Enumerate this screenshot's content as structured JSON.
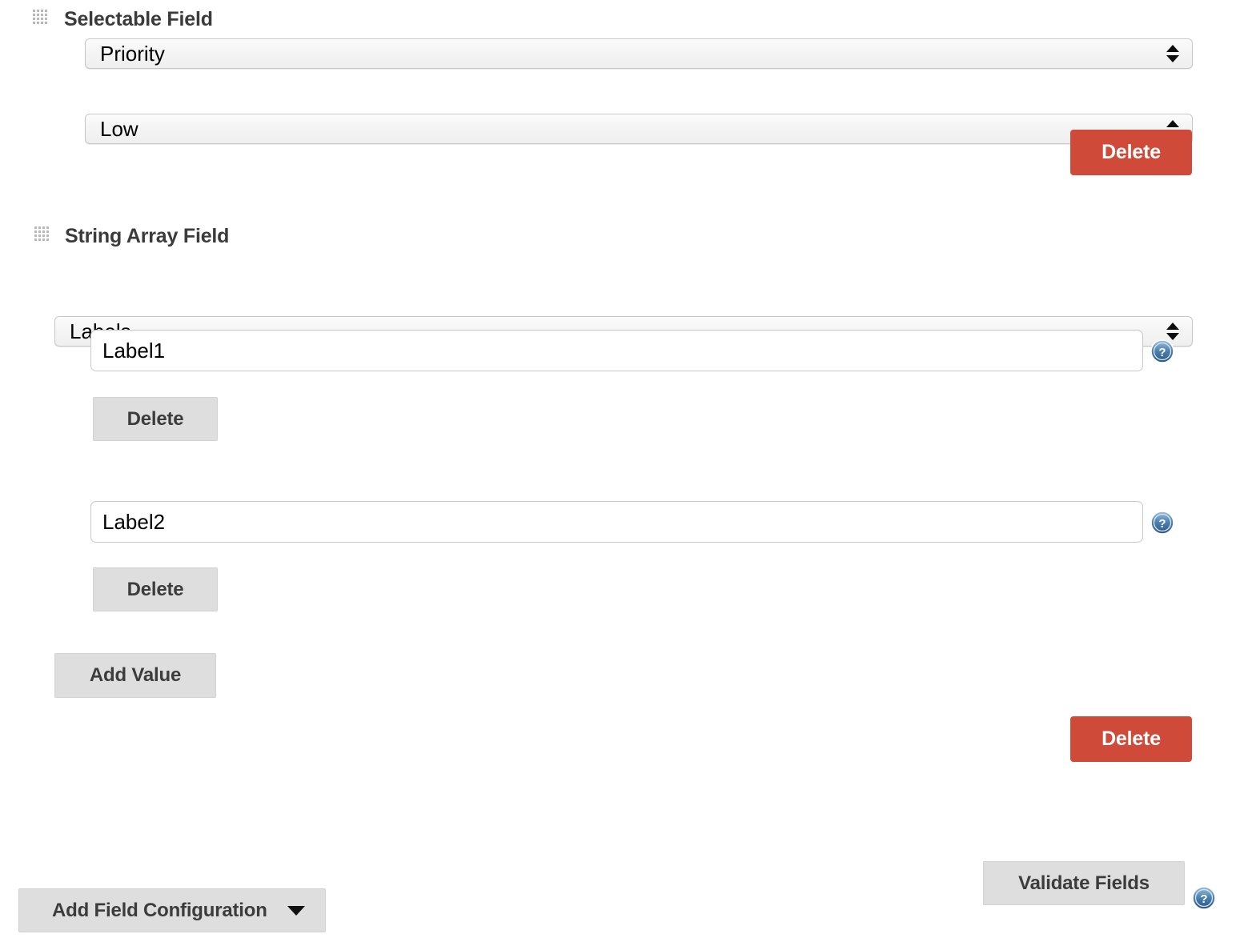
{
  "sections": [
    {
      "title": "Selectable Field",
      "drag_handle_icon": "drag-grip-icon",
      "field_select": {
        "value": "Priority"
      },
      "value_select": {
        "value": "Low"
      },
      "delete_label": "Delete"
    },
    {
      "title": "String Array Field",
      "drag_handle_icon": "drag-grip-icon",
      "field_select": {
        "value": "Labels"
      },
      "values": [
        {
          "value": "Label1",
          "placeholder": "",
          "delete_label": "Delete",
          "help_icon": "help-circle-icon"
        },
        {
          "value": "Label2",
          "placeholder": "",
          "delete_label": "Delete",
          "help_icon": "help-circle-icon"
        }
      ],
      "add_value_label": "Add Value",
      "delete_label": "Delete"
    }
  ],
  "footer": {
    "add_field_configuration_label": "Add Field Configuration",
    "dropdown_caret_icon": "chevron-down-icon",
    "validate_fields_label": "Validate Fields",
    "help_icon": "help-circle-icon"
  },
  "colors": {
    "danger": "#cf4a39",
    "button_gray": "#dedede",
    "text_dark": "#3b3b3b",
    "help_blue": "#2f6193"
  }
}
